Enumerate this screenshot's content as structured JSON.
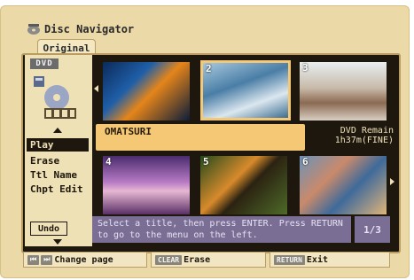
{
  "window": {
    "title": "Disc Navigator"
  },
  "tab": {
    "label": "Original"
  },
  "sidebar": {
    "disc_type": "DVD",
    "menu": [
      {
        "label": "Play",
        "active": true
      },
      {
        "label": "Erase",
        "active": false
      },
      {
        "label": "Ttl Name",
        "active": false
      },
      {
        "label": "Chpt Edit",
        "active": false
      }
    ],
    "undo_label": "Undo"
  },
  "thumbnails": [
    {
      "num": "",
      "selected": false
    },
    {
      "num": "2",
      "selected": true
    },
    {
      "num": "3",
      "selected": false
    },
    {
      "num": "4",
      "selected": false
    },
    {
      "num": "5",
      "selected": false
    },
    {
      "num": "6",
      "selected": false
    }
  ],
  "info": {
    "title": "OMATSURI",
    "remain_label": "DVD Remain",
    "remain_value": "1h37m(FINE)"
  },
  "message": {
    "text": "Select a title, then press ENTER. Press RETURN to go to the menu on the left.",
    "page": "1/3"
  },
  "footer": {
    "change_page": "Change page",
    "erase": "Erase",
    "exit": "Exit",
    "clear_key": "CLEAR",
    "return_key": "RETURN"
  }
}
